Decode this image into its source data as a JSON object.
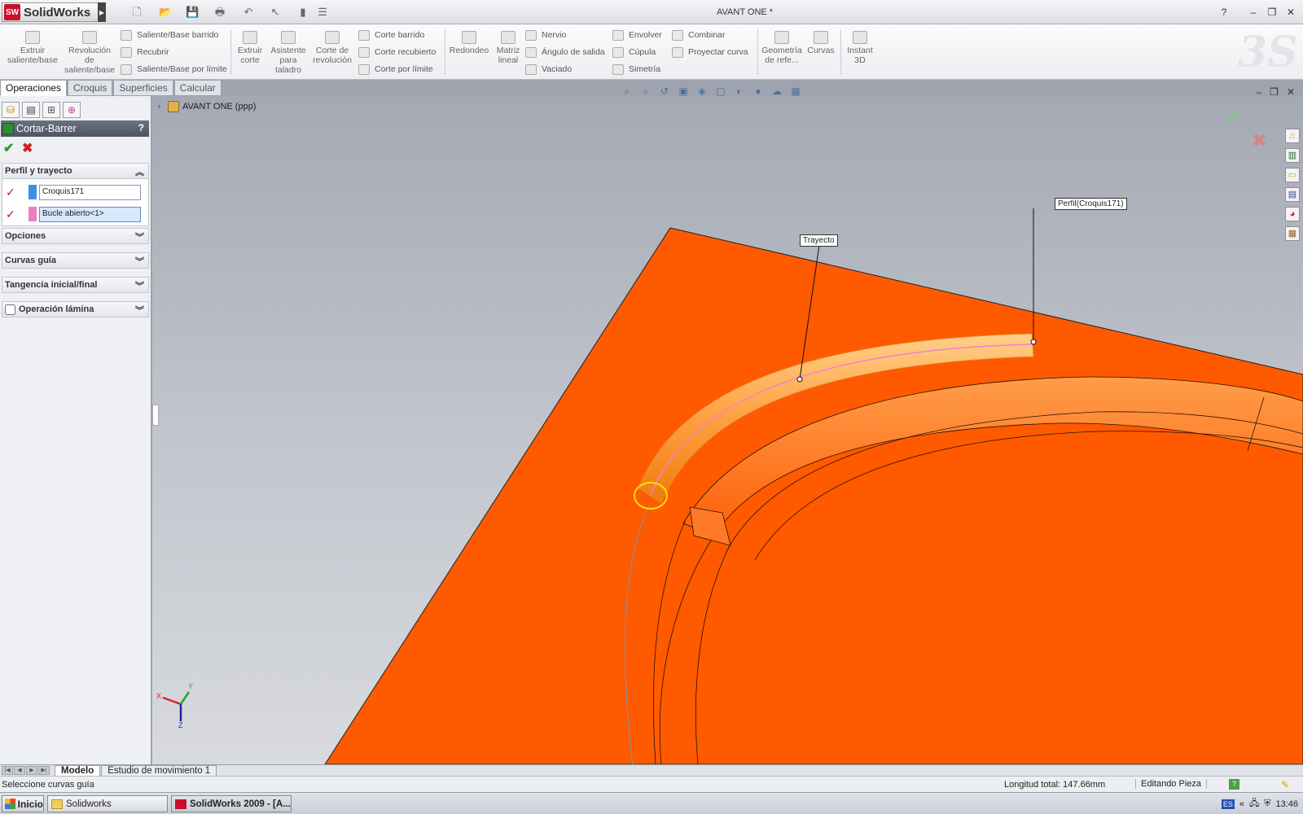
{
  "app": {
    "name": "SolidWorks",
    "logo_mark": "SW",
    "document_title": "AVANT ONE *"
  },
  "quick_access": [
    {
      "icon": "new-document-icon"
    },
    {
      "icon": "open-folder-icon"
    },
    {
      "icon": "save-icon"
    },
    {
      "icon": "print-icon"
    },
    {
      "icon": "undo-icon"
    },
    {
      "icon": "select-cursor-icon"
    },
    {
      "icon": "rebuild-icon"
    },
    {
      "icon": "options-icon"
    }
  ],
  "title_controls": {
    "help": "?",
    "minimize": "–",
    "restore": "❐",
    "close": "✕"
  },
  "ribbon": {
    "extrude_boss": "Extruir saliente/base",
    "revolve_boss": "Revolución de saliente/base",
    "sweep_boss": "Saliente/Base barrido",
    "loft": "Recubrir",
    "boundary_boss": "Saliente/Base por límite",
    "extrude_cut": "Extruir corte",
    "hole_wizard": "Asistente para taladro",
    "revolve_cut": "Corte de revolución",
    "sweep_cut": "Corte barrido",
    "loft_cut": "Corte recubierto",
    "boundary_cut": "Corte por límite",
    "fillet": "Redondeo",
    "linear_pattern": "Matriz lineal",
    "rib": "Nervio",
    "draft": "Ángulo de salida",
    "shell": "Vaciado",
    "wrap": "Envolver",
    "dome": "Cúpula",
    "mirror": "Simetría",
    "combine": "Combinar",
    "project_curve": "Proyectar curva",
    "ref_geometry": "Geometría de refe...",
    "curves": "Curvas",
    "instant3d": "Instant 3D"
  },
  "command_tabs": [
    "Operaciones",
    "Croquis",
    "Superficies",
    "Calcular"
  ],
  "property_manager": {
    "title": "Cortar-Barrer",
    "help": "?",
    "ok": "✔",
    "cancel": "✖",
    "groups": {
      "profile_path": "Perfil y trayecto",
      "options": "Opciones",
      "guide_curves": "Curvas guía",
      "tangency": "Tangencia inicial/final",
      "thin_feature": "Operación lámina"
    },
    "profile_value": "Croquis171",
    "path_value": "Bucle abierto<1>",
    "profile_color": "#3f8fe0",
    "path_color": "#ec7fc4"
  },
  "tree": {
    "root": "AVANT ONE  (ppp)"
  },
  "viewport": {
    "callout_path": "Trayecto",
    "callout_profile": "Perfil(Croquis171)",
    "part_color": "#ff5a00",
    "sweep_preview_color": "#ffa64d",
    "triad": {
      "x": "X",
      "y": "Y",
      "z": "Z"
    }
  },
  "bottom_tabs": [
    "Modelo",
    "Estudio de movimiento 1"
  ],
  "status": {
    "message": "Seleccione curvas guía",
    "length": "Longitud total:  147.66mm",
    "mode": "Editando Pieza"
  },
  "taskbar": {
    "start": "Inicio",
    "tasks": [
      "Solidworks",
      "SolidWorks 2009 - [A..."
    ],
    "lang": "ES",
    "clock": "13:46"
  }
}
